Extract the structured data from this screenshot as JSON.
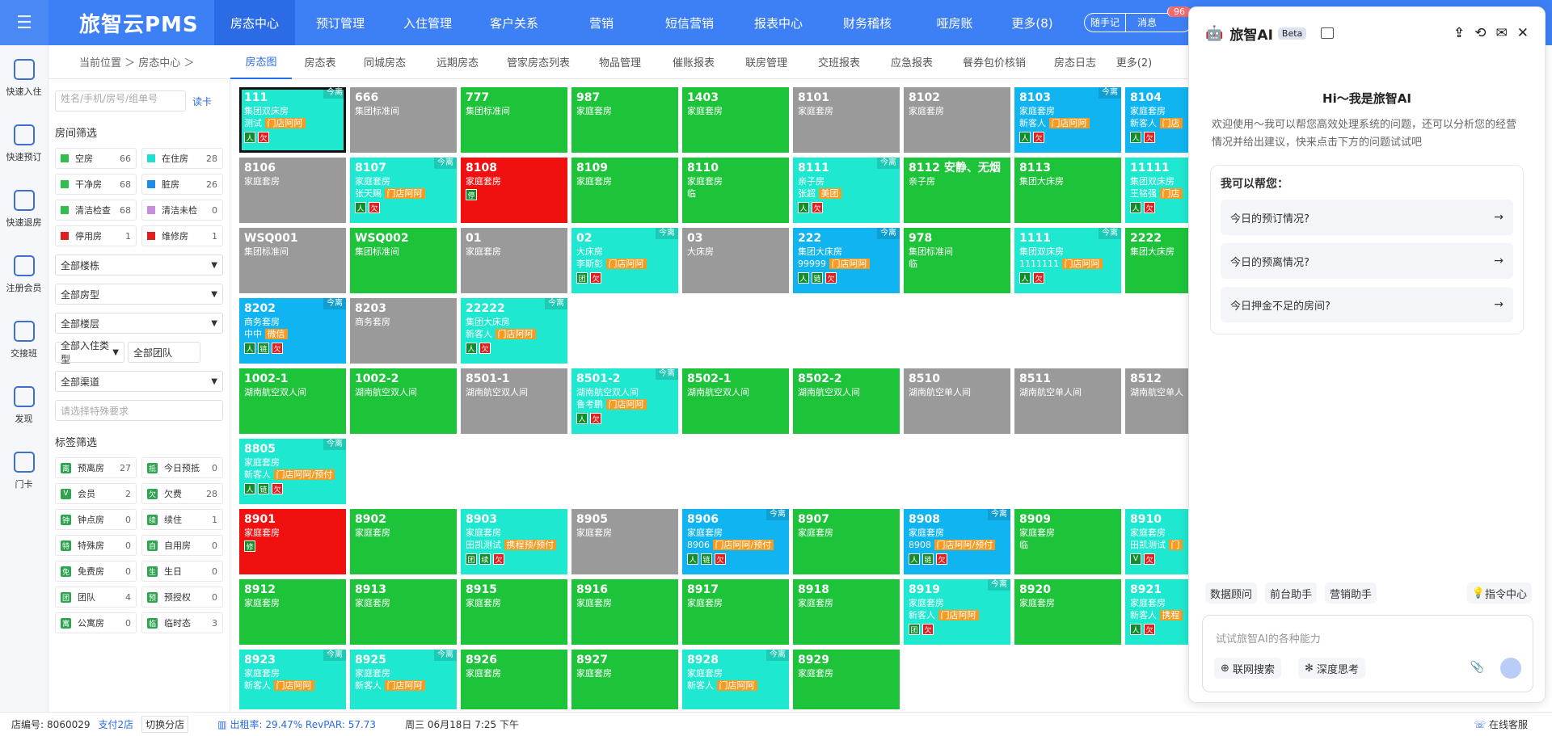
{
  "app": {
    "title": "旅智云PMS",
    "menu_icon": "menu-icon"
  },
  "topnav": [
    {
      "label": "房态中心",
      "active": true,
      "w": 100
    },
    {
      "label": "预订管理",
      "w": 112
    },
    {
      "label": "入住管理",
      "w": 104
    },
    {
      "label": "客户关系",
      "w": 110
    },
    {
      "label": "营销",
      "w": 106
    },
    {
      "label": "短信营销",
      "w": 112
    },
    {
      "label": "报表中心",
      "w": 108
    },
    {
      "label": "财务稽核",
      "w": 112
    },
    {
      "label": "哑房账",
      "w": 104
    },
    {
      "label": "更多(8)",
      "w": 88
    }
  ],
  "top_actions": {
    "notes": "随手记",
    "messages": "消息",
    "badge": "96"
  },
  "left_nav": [
    {
      "label": "快速入住",
      "icon": "house-icon"
    },
    {
      "label": "快速预订",
      "icon": "clipboard-icon"
    },
    {
      "label": "快速退房",
      "icon": "checkout-icon"
    },
    {
      "label": "注册会员",
      "icon": "user-icon"
    },
    {
      "label": "交接班",
      "icon": "handover-icon"
    },
    {
      "label": "发现",
      "icon": "discover-icon"
    },
    {
      "label": "门卡",
      "icon": "card-icon"
    }
  ],
  "breadcrumb": "当前位置 ＞ 房态中心 ＞",
  "tabs": [
    {
      "label": "房态图",
      "active": true,
      "w": 76
    },
    {
      "label": "房态表",
      "w": 70
    },
    {
      "label": "同城房态",
      "w": 90
    },
    {
      "label": "远期房态",
      "w": 90
    },
    {
      "label": "管家房态列表",
      "w": 110
    },
    {
      "label": "物品管理",
      "w": 92
    },
    {
      "label": "催账报表",
      "w": 90
    },
    {
      "label": "联房管理",
      "w": 90
    },
    {
      "label": "交班报表",
      "w": 90
    },
    {
      "label": "应急报表",
      "w": 90
    },
    {
      "label": "餐券包价核销",
      "w": 114
    },
    {
      "label": "房态日志",
      "w": 86
    },
    {
      "label": "更多(2)",
      "w": 60
    }
  ],
  "filter": {
    "search_placeholder": "姓名/手机/房号/组单号",
    "read_card": "读卡",
    "room_filter_title": "房间筛选",
    "statuses": [
      {
        "label": "空房",
        "count": "66",
        "color": "#2fbf4a"
      },
      {
        "label": "在住房",
        "count": "28",
        "color": "#1fe0d0"
      },
      {
        "label": "干净房",
        "count": "68",
        "color": "#2fbf4a"
      },
      {
        "label": "脏房",
        "count": "26",
        "color": "#1e8de8"
      },
      {
        "label": "清洁检查",
        "count": "68",
        "color": "#2fbf4a"
      },
      {
        "label": "清洁未检",
        "count": "0",
        "color": "#c98de0"
      },
      {
        "label": "停用房",
        "count": "1",
        "color": "#e02020"
      },
      {
        "label": "维修房",
        "count": "1",
        "color": "#e02020"
      }
    ],
    "selects": [
      "全部楼栋",
      "全部房型",
      "全部楼层"
    ],
    "checkin_type": "全部入住类型",
    "team": "全部团队",
    "channel": "全部渠道",
    "special_placeholder": "请选择特殊要求",
    "tag_filter_title": "标签筛选",
    "tags": [
      {
        "label": "预离房",
        "count": "27",
        "icon": "离"
      },
      {
        "label": "今日预抵",
        "count": "0",
        "icon": "抵"
      },
      {
        "label": "会员",
        "count": "2",
        "icon": "V"
      },
      {
        "label": "欠费",
        "count": "28",
        "icon": "欠"
      },
      {
        "label": "钟点房",
        "count": "0",
        "icon": "钟"
      },
      {
        "label": "续住",
        "count": "1",
        "icon": "续"
      },
      {
        "label": "特殊房",
        "count": "0",
        "icon": "特"
      },
      {
        "label": "自用房",
        "count": "0",
        "icon": "自"
      },
      {
        "label": "免费房",
        "count": "0",
        "icon": "免"
      },
      {
        "label": "生日",
        "count": "0",
        "icon": "生"
      },
      {
        "label": "团队",
        "count": "4",
        "icon": "团"
      },
      {
        "label": "预授权",
        "count": "0",
        "icon": "预"
      },
      {
        "label": "公寓房",
        "count": "0",
        "icon": "寓"
      },
      {
        "label": "临时态",
        "count": "3",
        "icon": "临"
      }
    ]
  },
  "room_today_label": "今离",
  "rooms": [
    {
      "num": "111",
      "type": "集团双床房",
      "guest": "测试",
      "tag": "门店阿阿",
      "color": "#1fe8d0",
      "today": true,
      "icons": [
        "人",
        "欠"
      ],
      "row": 0,
      "col": 0,
      "sel": true
    },
    {
      "num": "666",
      "type": "集团标准间",
      "color": "#9a9a9a",
      "row": 0,
      "col": 1
    },
    {
      "num": "777",
      "type": "集团标准间",
      "color": "#1dc43a",
      "row": 0,
      "col": 2
    },
    {
      "num": "987",
      "type": "家庭套房",
      "color": "#1dc43a",
      "row": 0,
      "col": 3
    },
    {
      "num": "1403",
      "type": "家庭套房",
      "color": "#1dc43a",
      "row": 0,
      "col": 4
    },
    {
      "num": "8101",
      "type": "家庭套房",
      "color": "#9a9a9a",
      "row": 0,
      "col": 5
    },
    {
      "num": "8102",
      "type": "家庭套房",
      "color": "#9a9a9a",
      "row": 0,
      "col": 6
    },
    {
      "num": "8103",
      "type": "家庭套房",
      "guest": "新客人",
      "tag": "门店阿阿",
      "color": "#10b4f0",
      "today": true,
      "icons": [
        "人",
        "欠"
      ],
      "row": 0,
      "col": 7
    },
    {
      "num": "8104",
      "type": "家庭套房",
      "guest": "新客人",
      "tag": "门店",
      "color": "#10b4f0",
      "today": true,
      "icons": [
        "人",
        "欠"
      ],
      "row": 0,
      "col": 8
    },
    {
      "num": "8106",
      "type": "家庭套房",
      "color": "#9a9a9a",
      "row": 1,
      "col": 0
    },
    {
      "num": "8107",
      "type": "家庭套房",
      "guest": "张天赐",
      "tag": "门店阿阿",
      "color": "#1fe8d0",
      "today": true,
      "icons": [
        "人",
        "欠"
      ],
      "row": 1,
      "col": 1
    },
    {
      "num": "8108",
      "type": "家庭套房",
      "color": "#f01010",
      "icons": [
        "停"
      ],
      "row": 1,
      "col": 2
    },
    {
      "num": "8109",
      "type": "家庭套房",
      "color": "#1dc43a",
      "row": 1,
      "col": 3
    },
    {
      "num": "8110",
      "type": "家庭套房",
      "guest": "临",
      "color": "#1dc43a",
      "row": 1,
      "col": 4
    },
    {
      "num": "8111",
      "type": "亲子房",
      "guest": "张超",
      "tag": "美团",
      "color": "#1fe8d0",
      "today": true,
      "icons": [
        "人",
        "欠"
      ],
      "row": 1,
      "col": 5
    },
    {
      "num": "8112 安静、无烟",
      "type": "亲子房",
      "color": "#1dc43a",
      "row": 1,
      "col": 6
    },
    {
      "num": "8113",
      "type": "集团大床房",
      "color": "#1dc43a",
      "row": 1,
      "col": 7
    },
    {
      "num": "11111",
      "type": "集团双床房",
      "guest": "王铭强",
      "tag": "门店",
      "color": "#1fe8d0",
      "today": true,
      "icons": [
        "人",
        "欠"
      ],
      "row": 1,
      "col": 8
    },
    {
      "num": "WSQ001",
      "type": "集团标准间",
      "color": "#9a9a9a",
      "row": 2,
      "col": 0
    },
    {
      "num": "WSQ002",
      "type": "集团标准间",
      "color": "#1dc43a",
      "row": 2,
      "col": 1
    },
    {
      "num": "01",
      "type": "家庭套房",
      "color": "#9a9a9a",
      "row": 2,
      "col": 2
    },
    {
      "num": "02",
      "type": "大床房",
      "guest": "李斯彭",
      "tag": "门店阿阿",
      "color": "#1fe8d0",
      "today": true,
      "icons": [
        "团",
        "欠"
      ],
      "row": 2,
      "col": 3
    },
    {
      "num": "03",
      "type": "大床房",
      "color": "#9a9a9a",
      "row": 2,
      "col": 4
    },
    {
      "num": "222",
      "type": "集团大床房",
      "guest": "99999",
      "tag": "门店阿阿",
      "color": "#10b4f0",
      "today": true,
      "icons": [
        "人",
        "链",
        "欠"
      ],
      "row": 2,
      "col": 5
    },
    {
      "num": "978",
      "type": "集团标准间",
      "guest": "临",
      "color": "#1dc43a",
      "row": 2,
      "col": 6
    },
    {
      "num": "1111",
      "type": "集团双床房",
      "guest": "1111111",
      "tag": "门店阿阿",
      "color": "#1fe8d0",
      "today": true,
      "icons": [
        "人",
        "欠"
      ],
      "row": 2,
      "col": 7
    },
    {
      "num": "2222",
      "type": "集团大床房",
      "color": "#1dc43a",
      "row": 2,
      "col": 8
    },
    {
      "num": "8202",
      "type": "商务套房",
      "guest": "中中",
      "tag": "微信",
      "color": "#10b4f0",
      "today": true,
      "icons": [
        "人",
        "链",
        "欠"
      ],
      "row": 3,
      "col": 0
    },
    {
      "num": "8203",
      "type": "商务套房",
      "color": "#9a9a9a",
      "row": 3,
      "col": 1
    },
    {
      "num": "22222",
      "type": "集团大床房",
      "guest": "新客人",
      "tag": "门店阿阿",
      "color": "#1fe8d0",
      "today": true,
      "icons": [
        "人",
        "欠"
      ],
      "row": 3,
      "col": 2
    },
    {
      "num": "1002-1",
      "type": "湖南航空双人间",
      "color": "#1dc43a",
      "row": 4,
      "col": 0
    },
    {
      "num": "1002-2",
      "type": "湖南航空双人间",
      "color": "#1dc43a",
      "row": 4,
      "col": 1
    },
    {
      "num": "8501-1",
      "type": "湖南航空双人间",
      "color": "#9a9a9a",
      "row": 4,
      "col": 2
    },
    {
      "num": "8501-2",
      "type": "湖南航空双人间",
      "guest": "鲁考鹏",
      "tag": "门店阿阿",
      "color": "#1fe8d0",
      "today": true,
      "icons": [
        "人",
        "欠"
      ],
      "row": 4,
      "col": 3
    },
    {
      "num": "8502-1",
      "type": "湖南航空双人间",
      "color": "#1dc43a",
      "row": 4,
      "col": 4
    },
    {
      "num": "8502-2",
      "type": "湖南航空双人间",
      "color": "#1dc43a",
      "row": 4,
      "col": 5
    },
    {
      "num": "8510",
      "type": "湖南航空单人间",
      "color": "#9a9a9a",
      "row": 4,
      "col": 6
    },
    {
      "num": "8511",
      "type": "湖南航空单人间",
      "color": "#9a9a9a",
      "row": 4,
      "col": 7
    },
    {
      "num": "8512",
      "type": "湖南航空单人",
      "color": "#9a9a9a",
      "row": 4,
      "col": 8
    },
    {
      "num": "8805",
      "type": "家庭套房",
      "guest": "新客人",
      "tag": "门店阿阿/预付",
      "color": "#1fe8d0",
      "today": true,
      "icons": [
        "人",
        "链",
        "欠"
      ],
      "row": 5,
      "col": 0
    },
    {
      "num": "8901",
      "type": "家庭套房",
      "color": "#f01010",
      "icons": [
        "修"
      ],
      "row": 6,
      "col": 0
    },
    {
      "num": "8902",
      "type": "家庭套房",
      "color": "#1dc43a",
      "row": 6,
      "col": 1
    },
    {
      "num": "8903",
      "type": "家庭套房",
      "guest": "田凯测试",
      "tag": "携程预/预付",
      "color": "#1fe8d0",
      "icons": [
        "团",
        "续",
        "欠"
      ],
      "row": 6,
      "col": 2
    },
    {
      "num": "8905",
      "type": "家庭套房",
      "color": "#9a9a9a",
      "row": 6,
      "col": 3
    },
    {
      "num": "8906",
      "type": "家庭套房",
      "guest": "8906",
      "tag": "门店阿阿/预付",
      "color": "#10b4f0",
      "today": true,
      "icons": [
        "人",
        "链",
        "欠"
      ],
      "row": 6,
      "col": 4
    },
    {
      "num": "8907",
      "type": "家庭套房",
      "color": "#1dc43a",
      "row": 6,
      "col": 5
    },
    {
      "num": "8908",
      "type": "家庭套房",
      "guest": "8908",
      "tag": "门店阿阿/预付",
      "color": "#10b4f0",
      "today": true,
      "icons": [
        "人",
        "链",
        "欠"
      ],
      "row": 6,
      "col": 6
    },
    {
      "num": "8909",
      "type": "家庭套房",
      "guest": "临",
      "color": "#1dc43a",
      "row": 6,
      "col": 7
    },
    {
      "num": "8910",
      "type": "家庭套房",
      "guest": "田凯测试",
      "tag": "门",
      "color": "#1fe8d0",
      "today": true,
      "icons": [
        "V",
        "欠"
      ],
      "row": 6,
      "col": 8
    },
    {
      "num": "8912",
      "type": "家庭套房",
      "color": "#1dc43a",
      "row": 7,
      "col": 0
    },
    {
      "num": "8913",
      "type": "家庭套房",
      "color": "#1dc43a",
      "row": 7,
      "col": 1
    },
    {
      "num": "8915",
      "type": "家庭套房",
      "color": "#1dc43a",
      "row": 7,
      "col": 2
    },
    {
      "num": "8916",
      "type": "家庭套房",
      "color": "#1dc43a",
      "row": 7,
      "col": 3
    },
    {
      "num": "8917",
      "type": "家庭套房",
      "color": "#1dc43a",
      "row": 7,
      "col": 4
    },
    {
      "num": "8918",
      "type": "家庭套房",
      "color": "#1dc43a",
      "row": 7,
      "col": 5
    },
    {
      "num": "8919",
      "type": "家庭套房",
      "guest": "新客人",
      "tag": "门店阿阿",
      "color": "#1fe8d0",
      "today": true,
      "icons": [
        "团",
        "欠"
      ],
      "row": 7,
      "col": 6
    },
    {
      "num": "8920",
      "type": "家庭套房",
      "color": "#1dc43a",
      "row": 7,
      "col": 7
    },
    {
      "num": "8921",
      "type": "家庭套房",
      "guest": "新客人",
      "tag": "携程",
      "color": "#1fe8d0",
      "today": true,
      "icons": [
        "人",
        "欠"
      ],
      "row": 7,
      "col": 8
    },
    {
      "num": "8923",
      "type": "家庭套房",
      "guest": "新客人",
      "tag": "门店阿阿",
      "color": "#1fe8d0",
      "today": true,
      "row": 8,
      "col": 0
    },
    {
      "num": "8925",
      "type": "家庭套房",
      "guest": "新客人",
      "tag": "门店阿阿",
      "color": "#1fe8d0",
      "today": true,
      "row": 8,
      "col": 1
    },
    {
      "num": "8926",
      "type": "家庭套房",
      "color": "#1dc43a",
      "row": 8,
      "col": 2
    },
    {
      "num": "8927",
      "type": "家庭套房",
      "color": "#1dc43a",
      "row": 8,
      "col": 3
    },
    {
      "num": "8928",
      "type": "家庭套房",
      "guest": "新客人",
      "tag": "门店阿阿",
      "color": "#1fe8d0",
      "today": true,
      "row": 8,
      "col": 4
    },
    {
      "num": "8929",
      "type": "家庭套房",
      "color": "#1dc43a",
      "row": 8,
      "col": 5
    }
  ],
  "ai": {
    "title": "旅智AI",
    "beta": "Beta",
    "greeting": "Hi～我是旅智AI",
    "desc": "欢迎使用～我可以帮您高效处理系统的问题，还可以分析您的经营情况并给出建议，快来点击下方的问题试试吧",
    "card_title": "我可以帮您：",
    "questions": [
      "今日的预订情况?",
      "今日的预离情况?",
      "今日押金不足的房间?"
    ],
    "tools": [
      "数据顾问",
      "前台助手",
      "营销助手"
    ],
    "command_center": "指令中心",
    "input_placeholder": "试试旅智AI的各种能力",
    "web_search": "联网搜索",
    "deep_think": "深度思考"
  },
  "status": {
    "store_label": "店编号:",
    "store_no": "8060029",
    "branch": "支付2店",
    "switch": "切换分店",
    "occupancy": "出租率: 29.47% RevPAR: 57.73",
    "datetime": "周三 06月18日 7:25 下午",
    "service": "在线客服"
  }
}
